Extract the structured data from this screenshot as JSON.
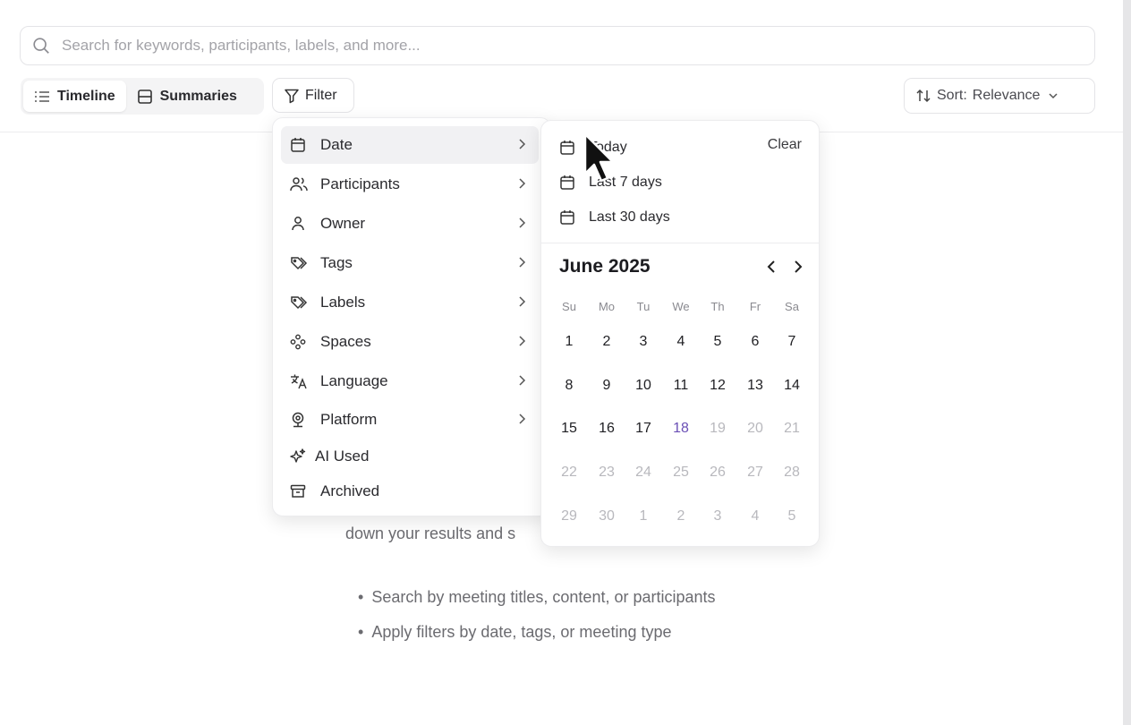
{
  "search": {
    "placeholder": "Search for keywords, participants, labels, and more..."
  },
  "view_toggle": {
    "timeline_label": "Timeline",
    "summaries_label": "Summaries",
    "active": "Timeline"
  },
  "filter": {
    "label": "Filter"
  },
  "sort": {
    "label": "Sort:",
    "value": "Relevance"
  },
  "background": {
    "partial_text": "down your results and s",
    "bullets": [
      "Search by meeting titles, content, or participants",
      "Apply filters by date, tags, or meeting type"
    ]
  },
  "filter_menu": {
    "items": [
      {
        "label": "Date",
        "icon": "calendar-icon",
        "has_submenu": true,
        "active": true
      },
      {
        "label": "Participants",
        "icon": "users-icon",
        "has_submenu": true
      },
      {
        "label": "Owner",
        "icon": "user-icon",
        "has_submenu": true
      },
      {
        "label": "Tags",
        "icon": "tag-icon",
        "has_submenu": true
      },
      {
        "label": "Labels",
        "icon": "label-icon",
        "has_submenu": true
      },
      {
        "label": "Spaces",
        "icon": "spaces-icon",
        "has_submenu": true
      },
      {
        "label": "Language",
        "icon": "language-icon",
        "has_submenu": true
      },
      {
        "label": "Platform",
        "icon": "webcam-icon",
        "has_submenu": true
      },
      {
        "label": "AI Used",
        "icon": "sparkles-icon",
        "has_submenu": false
      },
      {
        "label": "Archived",
        "icon": "archive-icon",
        "has_submenu": false
      }
    ]
  },
  "date_panel": {
    "presets": [
      "Today",
      "Last 7 days",
      "Last 30 days"
    ],
    "clear_label": "Clear",
    "month_title": "June 2025",
    "weekdays": [
      "Su",
      "Mo",
      "Tu",
      "We",
      "Th",
      "Fr",
      "Sa"
    ],
    "weeks": [
      [
        "1",
        "2",
        "3",
        "4",
        "5",
        "6",
        "7"
      ],
      [
        "8",
        "9",
        "10",
        "11",
        "12",
        "13",
        "14"
      ],
      [
        "15",
        "16",
        "17",
        "18",
        "19",
        "20",
        "21"
      ],
      [
        "22",
        "23",
        "24",
        "25",
        "26",
        "27",
        "28"
      ],
      [
        "29",
        "30",
        "1",
        "2",
        "3",
        "4",
        "5"
      ]
    ],
    "today": "18",
    "colors": {
      "today": "#6a4fb5",
      "muted": "#b8b8bd"
    }
  }
}
